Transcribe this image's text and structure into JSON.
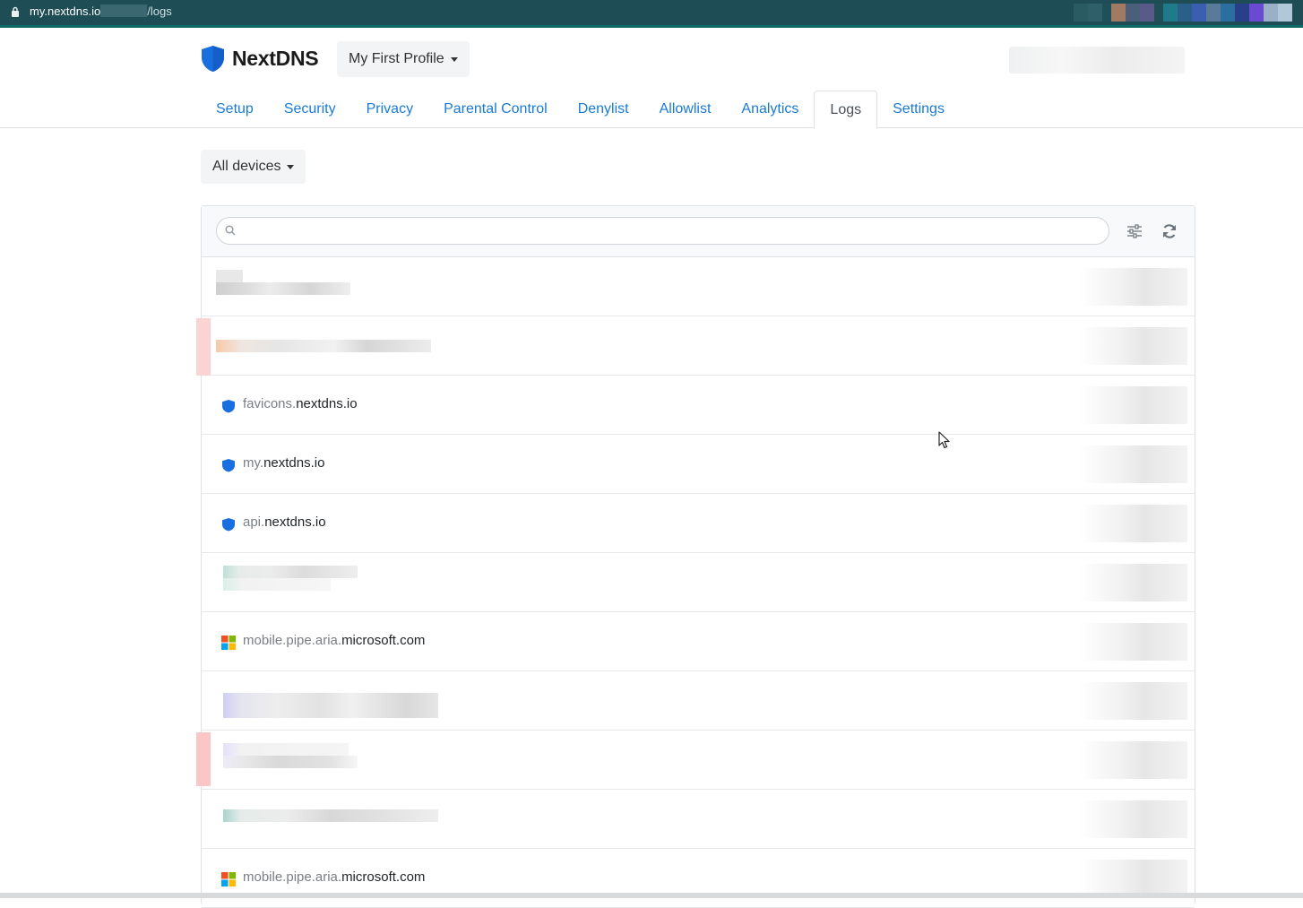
{
  "browser": {
    "url_host": "my.nextdns.io",
    "url_path": "/logs"
  },
  "app": {
    "brand": "NextDNS",
    "profile_label": "My First Profile"
  },
  "tabs": [
    {
      "label": "Setup",
      "active": false
    },
    {
      "label": "Security",
      "active": false
    },
    {
      "label": "Privacy",
      "active": false
    },
    {
      "label": "Parental Control",
      "active": false
    },
    {
      "label": "Denylist",
      "active": false
    },
    {
      "label": "Allowlist",
      "active": false
    },
    {
      "label": "Analytics",
      "active": false
    },
    {
      "label": "Logs",
      "active": true
    },
    {
      "label": "Settings",
      "active": false
    }
  ],
  "filters": {
    "devices_label": "All devices",
    "search_placeholder": ""
  },
  "logs": [
    {
      "redacted": true,
      "tint": "#dcdcdc"
    },
    {
      "redacted": true,
      "tint": "#f7c9a8",
      "blocked": true
    },
    {
      "sub": "favicons.",
      "root": "nextdns.io",
      "icon": "nextdns-shield-icon"
    },
    {
      "sub": "my.",
      "root": "nextdns.io",
      "icon": "nextdns-shield-icon"
    },
    {
      "sub": "api.",
      "root": "nextdns.io",
      "icon": "nextdns-shield-icon"
    },
    {
      "redacted": true,
      "tint": "#bfe0d8"
    },
    {
      "sub": "mobile.pipe.aria.",
      "root": "microsoft.com",
      "icon": "microsoft-logo-icon"
    },
    {
      "redacted": true,
      "tint": "#cfcff7"
    },
    {
      "redacted": true,
      "tint": "#e6e0fb",
      "blocked": true
    },
    {
      "redacted": true,
      "tint": "#a9d3cc"
    },
    {
      "sub": "mobile.pipe.aria.",
      "root": "microsoft.com",
      "icon": "microsoft-logo-icon"
    }
  ],
  "colors": {
    "link": "#1a7bd6",
    "brand_blue": "#1a6fe0",
    "browser_bar": "#1e4d56",
    "blocked": "#f8b4b4"
  }
}
